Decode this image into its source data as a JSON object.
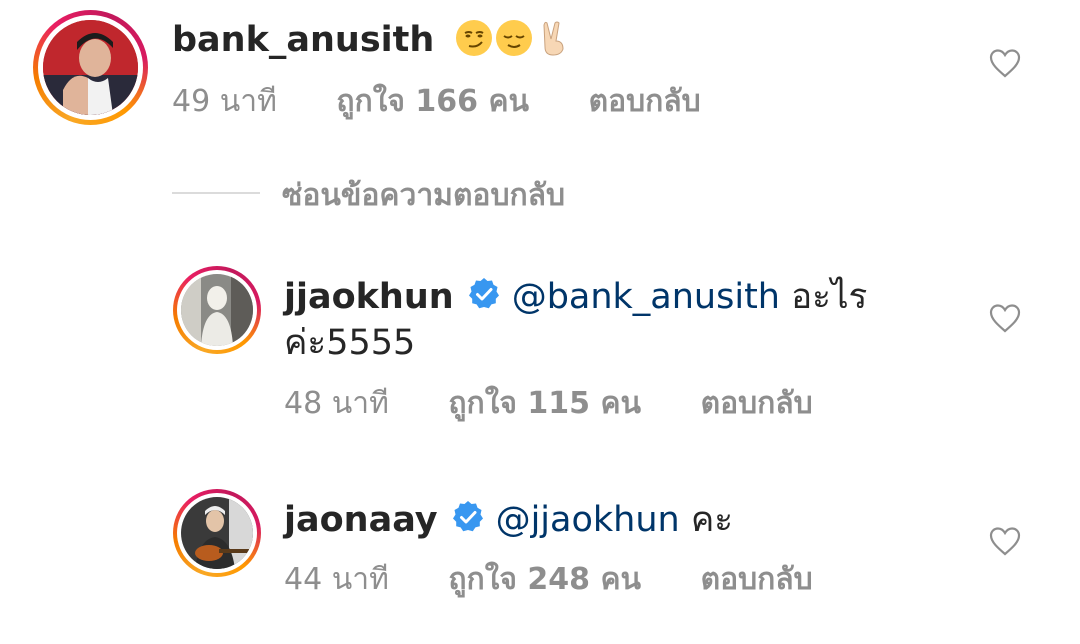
{
  "comments": [
    {
      "username": "bank_anusith",
      "verified": false,
      "mention": "",
      "text": "",
      "emojis": [
        "smirk-emoji",
        "relieved-emoji",
        "victory-hand-emoji"
      ],
      "time": "49 นาที",
      "likes": "ถูกใจ 166 คน",
      "reply": "ตอบกลับ"
    },
    {
      "username": "jjaokhun",
      "verified": true,
      "mention": "@bank_anusith",
      "text": "อะไร",
      "text_line2": "ค่ะ5555",
      "time": "48 นาที",
      "likes": "ถูกใจ 115 คน",
      "reply": "ตอบกลับ"
    },
    {
      "username": "jaonaay",
      "verified": true,
      "mention": "@jjaokhun",
      "text": "คะ",
      "time": "44 นาที",
      "likes": "ถูกใจ 248 คน",
      "reply": "ตอบกลับ"
    }
  ],
  "hide_replies_label": "ซ่อนข้อความตอบกลับ",
  "colors": {
    "username": "#262626",
    "mention": "#003569",
    "meta": "#8e8e8e",
    "verified": "#3897f0",
    "divider": "#dbdbdb"
  },
  "icons": [
    "heart-outline-icon",
    "verified-badge-icon"
  ]
}
